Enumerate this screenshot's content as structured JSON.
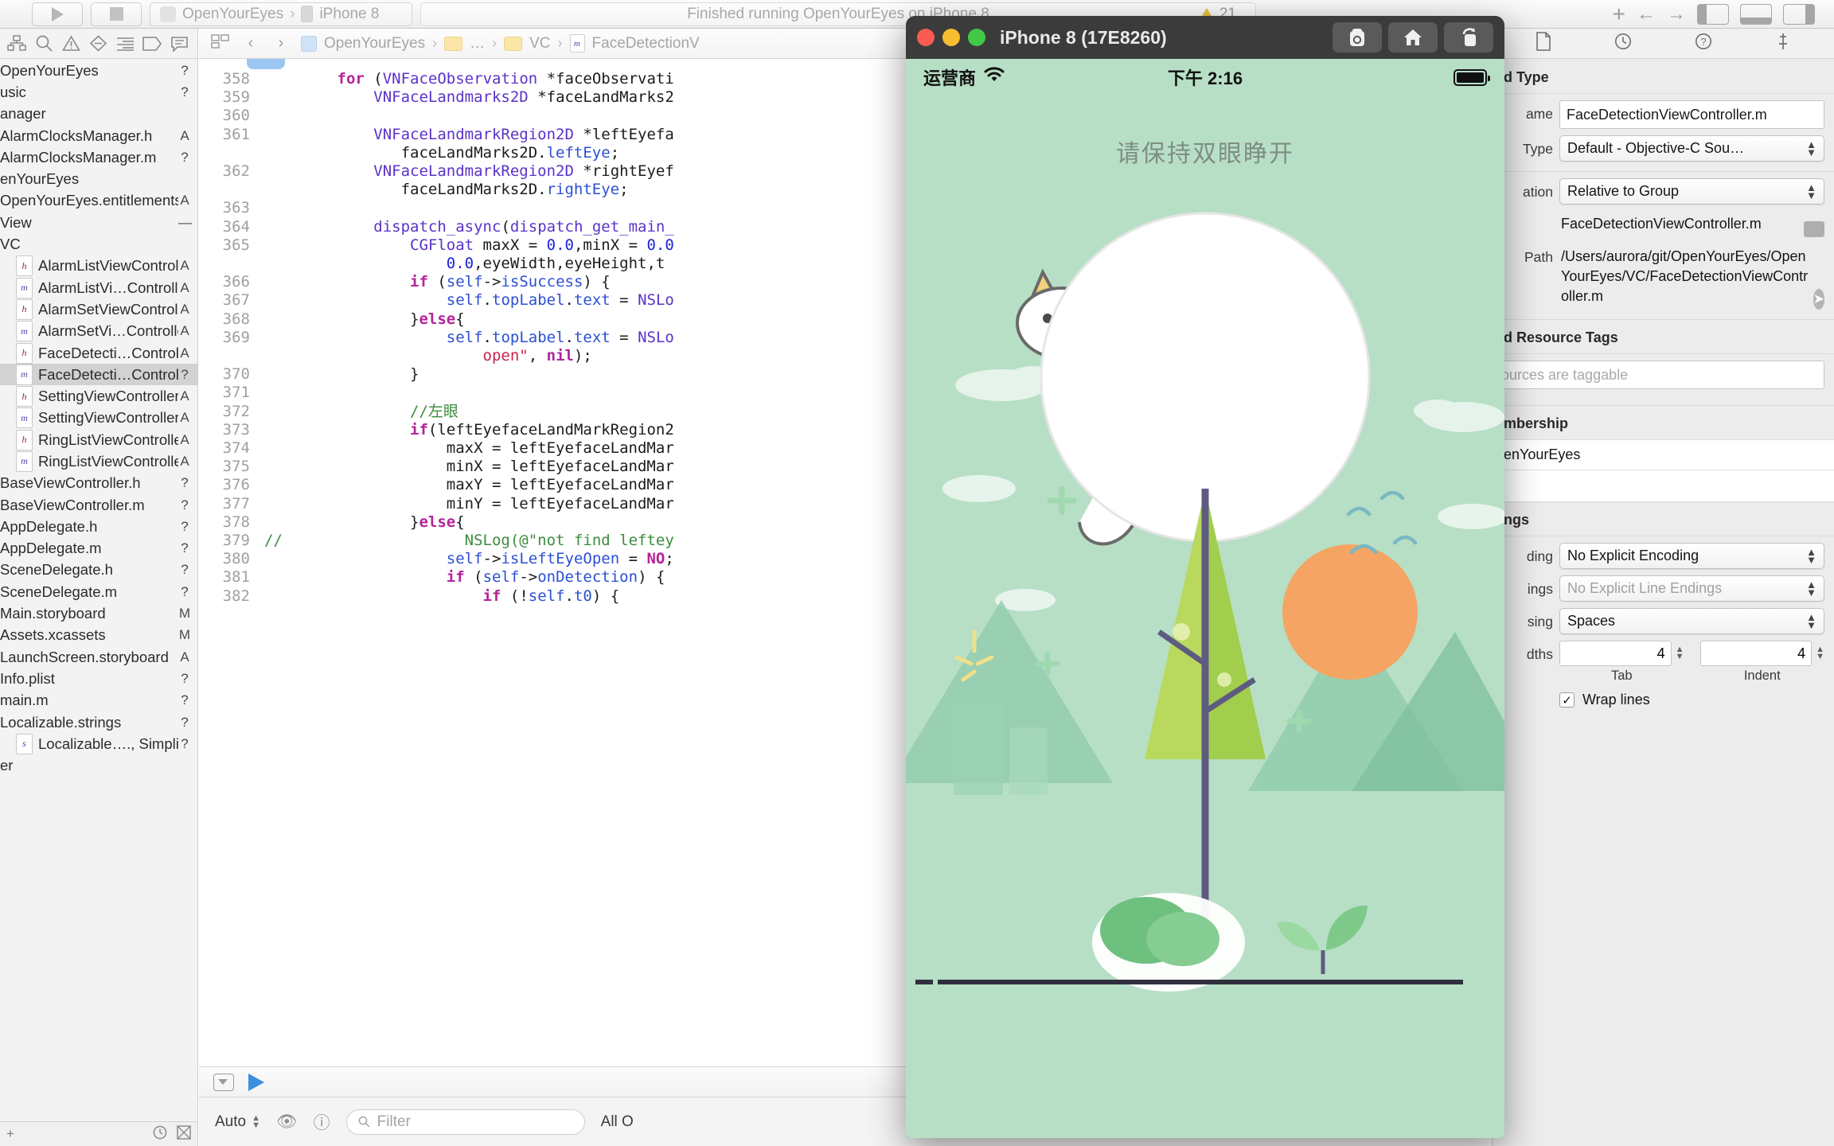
{
  "toolbar": {
    "scheme_project": "OpenYourEyes",
    "scheme_sep": "›",
    "scheme_device": "iPhone 8",
    "status_text": "Finished running OpenYourEyes on iPhone 8",
    "warning_count": "21",
    "add_label": "+"
  },
  "navigator": {
    "tabs": [
      "project-navigator-icon",
      "search-navigator-icon",
      "issue-navigator-icon",
      "test-navigator-icon",
      "report-navigator-icon",
      "breakpoint-navigator-icon",
      "debug-navigator-icon"
    ],
    "items": [
      {
        "label": "OpenYourEyes",
        "status": "?",
        "kind": "group",
        "indent": 0,
        "selected": false
      },
      {
        "label": "usic",
        "status": "?",
        "kind": "group",
        "indent": 0,
        "selected": false
      },
      {
        "label": "anager",
        "status": "",
        "kind": "group",
        "indent": 0,
        "selected": false
      },
      {
        "label": "AlarmClocksManager.h",
        "status": "A",
        "kind": "plain",
        "indent": 0,
        "selected": false
      },
      {
        "label": "AlarmClocksManager.m",
        "status": "?",
        "kind": "plain",
        "indent": 0,
        "selected": false
      },
      {
        "label": "enYourEyes",
        "status": "",
        "kind": "group",
        "indent": 0,
        "selected": false
      },
      {
        "label": "OpenYourEyes.entitlements",
        "status": "A",
        "kind": "plain",
        "indent": 0,
        "selected": false
      },
      {
        "label": "View",
        "status": "—",
        "kind": "group",
        "indent": 0,
        "selected": false
      },
      {
        "label": "VC",
        "status": "",
        "kind": "group",
        "indent": 0,
        "selected": false
      },
      {
        "label": "AlarmListViewController.h",
        "status": "A",
        "kind": "h",
        "indent": 1,
        "selected": false
      },
      {
        "label": "AlarmListVi…Controller.m",
        "status": "A",
        "kind": "m",
        "indent": 1,
        "selected": false
      },
      {
        "label": "AlarmSetViewController.h",
        "status": "A",
        "kind": "h",
        "indent": 1,
        "selected": false
      },
      {
        "label": "AlarmSetVi…Controller.m",
        "status": "A",
        "kind": "m",
        "indent": 1,
        "selected": false
      },
      {
        "label": "FaceDetecti…Controller.h",
        "status": "A",
        "kind": "h",
        "indent": 1,
        "selected": false
      },
      {
        "label": "FaceDetecti…Controller.m",
        "status": "?",
        "kind": "m",
        "indent": 1,
        "selected": true
      },
      {
        "label": "SettingViewController.h",
        "status": "A",
        "kind": "h",
        "indent": 1,
        "selected": false
      },
      {
        "label": "SettingViewController.m",
        "status": "A",
        "kind": "m",
        "indent": 1,
        "selected": false
      },
      {
        "label": "RingListViewController.h",
        "status": "A",
        "kind": "h",
        "indent": 1,
        "selected": false
      },
      {
        "label": "RingListViewController.m",
        "status": "A",
        "kind": "m",
        "indent": 1,
        "selected": false
      },
      {
        "label": "BaseViewController.h",
        "status": "?",
        "kind": "plain",
        "indent": 0,
        "selected": false
      },
      {
        "label": "BaseViewController.m",
        "status": "?",
        "kind": "plain",
        "indent": 0,
        "selected": false
      },
      {
        "label": "AppDelegate.h",
        "status": "?",
        "kind": "plain",
        "indent": 0,
        "selected": false
      },
      {
        "label": "AppDelegate.m",
        "status": "?",
        "kind": "plain",
        "indent": 0,
        "selected": false
      },
      {
        "label": "SceneDelegate.h",
        "status": "?",
        "kind": "plain",
        "indent": 0,
        "selected": false
      },
      {
        "label": "SceneDelegate.m",
        "status": "?",
        "kind": "plain",
        "indent": 0,
        "selected": false
      },
      {
        "label": "Main.storyboard",
        "status": "M",
        "kind": "plain",
        "indent": 0,
        "selected": false
      },
      {
        "label": "Assets.xcassets",
        "status": "M",
        "kind": "plain",
        "indent": 0,
        "selected": false
      },
      {
        "label": "LaunchScreen.storyboard",
        "status": "A",
        "kind": "plain",
        "indent": 0,
        "selected": false
      },
      {
        "label": "Info.plist",
        "status": "?",
        "kind": "plain",
        "indent": 0,
        "selected": false
      },
      {
        "label": "main.m",
        "status": "?",
        "kind": "plain",
        "indent": 0,
        "selected": false
      },
      {
        "label": "Localizable.strings",
        "status": "?",
        "kind": "plain",
        "indent": 0,
        "selected": false
      },
      {
        "label": "Localizable…., Simplified)",
        "status": "?",
        "kind": "strings",
        "indent": 1,
        "selected": false
      },
      {
        "label": "er",
        "status": "",
        "kind": "group",
        "indent": 0,
        "selected": false
      }
    ],
    "footer": {
      "add": "+",
      "filter_icon": "filter-icon",
      "recent_icon": "clock-icon",
      "source_icon": "source-control-icon"
    }
  },
  "editor": {
    "breadcrumb": [
      "OpenYourEyes",
      "…",
      "VC",
      "FaceDetectionV"
    ],
    "nav_back": "‹",
    "nav_fwd": "›",
    "lines": [
      {
        "n": "358",
        "tokens": [
          [
            "sp",
            "        "
          ],
          [
            "kw",
            "for"
          ],
          [
            "pl",
            " ("
          ],
          [
            "ty",
            "VNFaceObservation"
          ],
          [
            "pl",
            " *faceObservati"
          ]
        ]
      },
      {
        "n": "359",
        "tokens": [
          [
            "sp",
            "            "
          ],
          [
            "ty",
            "VNFaceLandmarks2D"
          ],
          [
            "pl",
            " *faceLandMarks2"
          ]
        ]
      },
      {
        "n": "360",
        "tokens": [
          [
            "pl",
            ""
          ]
        ]
      },
      {
        "n": "361",
        "tokens": [
          [
            "sp",
            "            "
          ],
          [
            "ty",
            "VNFaceLandmarkRegion2D"
          ],
          [
            "pl",
            " *leftEyefa"
          ]
        ]
      },
      {
        "n": "",
        "tokens": [
          [
            "sp",
            "               "
          ],
          [
            "pl",
            "faceLandMarks2D."
          ],
          [
            "pr",
            "leftEye"
          ],
          [
            "pl",
            ";"
          ]
        ]
      },
      {
        "n": "362",
        "tokens": [
          [
            "sp",
            "            "
          ],
          [
            "ty",
            "VNFaceLandmarkRegion2D"
          ],
          [
            "pl",
            " *rightEyef"
          ]
        ]
      },
      {
        "n": "",
        "tokens": [
          [
            "sp",
            "               "
          ],
          [
            "pl",
            "faceLandMarks2D."
          ],
          [
            "pr",
            "rightEye"
          ],
          [
            "pl",
            ";"
          ]
        ]
      },
      {
        "n": "363",
        "tokens": [
          [
            "pl",
            ""
          ]
        ]
      },
      {
        "n": "364",
        "tokens": [
          [
            "sp",
            "            "
          ],
          [
            "ty",
            "dispatch_async"
          ],
          [
            "pl",
            "("
          ],
          [
            "ty",
            "dispatch_get_main_"
          ]
        ]
      },
      {
        "n": "365",
        "tokens": [
          [
            "sp",
            "                "
          ],
          [
            "ty",
            "CGFloat"
          ],
          [
            "pl",
            " maxX = "
          ],
          [
            "num",
            "0.0"
          ],
          [
            "pl",
            ",minX = "
          ],
          [
            "num",
            "0.0"
          ]
        ]
      },
      {
        "n": "",
        "tokens": [
          [
            "sp",
            "                    "
          ],
          [
            "num",
            "0.0"
          ],
          [
            "pl",
            ",eyeWidth,eyeHeight,t"
          ]
        ]
      },
      {
        "n": "366",
        "tokens": [
          [
            "sp",
            "                "
          ],
          [
            "kw",
            "if"
          ],
          [
            "pl",
            " ("
          ],
          [
            "pr",
            "self"
          ],
          [
            "pl",
            "->"
          ],
          [
            "pr",
            "isSuccess"
          ],
          [
            "pl",
            ") {"
          ]
        ]
      },
      {
        "n": "367",
        "tokens": [
          [
            "sp",
            "                    "
          ],
          [
            "pr",
            "self"
          ],
          [
            "pl",
            "."
          ],
          [
            "pr",
            "topLabel"
          ],
          [
            "pl",
            "."
          ],
          [
            "pr",
            "text"
          ],
          [
            "pl",
            " = "
          ],
          [
            "ty",
            "NSLo"
          ]
        ]
      },
      {
        "n": "368",
        "tokens": [
          [
            "sp",
            "                "
          ],
          [
            "pl",
            "}"
          ],
          [
            "kw",
            "else"
          ],
          [
            "pl",
            "{"
          ]
        ]
      },
      {
        "n": "369",
        "tokens": [
          [
            "sp",
            "                    "
          ],
          [
            "pr",
            "self"
          ],
          [
            "pl",
            "."
          ],
          [
            "pr",
            "topLabel"
          ],
          [
            "pl",
            "."
          ],
          [
            "pr",
            "text"
          ],
          [
            "pl",
            " = "
          ],
          [
            "ty",
            "NSLo"
          ]
        ]
      },
      {
        "n": "",
        "tokens": [
          [
            "sp",
            "                        "
          ],
          [
            "str",
            "open\""
          ],
          [
            "pl",
            ", "
          ],
          [
            "kw",
            "nil"
          ],
          [
            "pl",
            ");"
          ]
        ]
      },
      {
        "n": "370",
        "tokens": [
          [
            "sp",
            "                "
          ],
          [
            "pl",
            "}"
          ]
        ]
      },
      {
        "n": "371",
        "tokens": [
          [
            "pl",
            ""
          ]
        ]
      },
      {
        "n": "372",
        "tokens": [
          [
            "sp",
            "                "
          ],
          [
            "cmt",
            "//左眼"
          ]
        ]
      },
      {
        "n": "373",
        "tokens": [
          [
            "sp",
            "                "
          ],
          [
            "kw",
            "if"
          ],
          [
            "pl",
            "(leftEyefaceLandMarkRegion2"
          ]
        ]
      },
      {
        "n": "374",
        "tokens": [
          [
            "sp",
            "                    "
          ],
          [
            "pl",
            "maxX = leftEyefaceLandMar"
          ]
        ]
      },
      {
        "n": "375",
        "tokens": [
          [
            "sp",
            "                    "
          ],
          [
            "pl",
            "minX = leftEyefaceLandMar"
          ]
        ]
      },
      {
        "n": "376",
        "tokens": [
          [
            "sp",
            "                    "
          ],
          [
            "pl",
            "maxY = leftEyefaceLandMar"
          ]
        ]
      },
      {
        "n": "377",
        "tokens": [
          [
            "sp",
            "                    "
          ],
          [
            "pl",
            "minY = leftEyefaceLandMar"
          ]
        ]
      },
      {
        "n": "378",
        "tokens": [
          [
            "sp",
            "                "
          ],
          [
            "pl",
            "}"
          ],
          [
            "kw",
            "else"
          ],
          [
            "pl",
            "{"
          ]
        ]
      },
      {
        "n": "379",
        "tokens": [
          [
            "cmtpre",
            "//"
          ],
          [
            "sp",
            "                    "
          ],
          [
            "cmt",
            "NSLog(@\"not find leftey"
          ]
        ]
      },
      {
        "n": "380",
        "tokens": [
          [
            "sp",
            "                    "
          ],
          [
            "pr",
            "self"
          ],
          [
            "pl",
            "->"
          ],
          [
            "pr",
            "isLeftEyeOpen"
          ],
          [
            "pl",
            " = "
          ],
          [
            "kw",
            "NO"
          ],
          [
            "pl",
            ";"
          ]
        ]
      },
      {
        "n": "381",
        "tokens": [
          [
            "sp",
            "                    "
          ],
          [
            "kw",
            "if"
          ],
          [
            "pl",
            " ("
          ],
          [
            "pr",
            "self"
          ],
          [
            "pl",
            "->"
          ],
          [
            "pr",
            "onDetection"
          ],
          [
            "pl",
            ") {"
          ]
        ]
      },
      {
        "n": "382",
        "tokens": [
          [
            "sp",
            "                        "
          ],
          [
            "kw",
            "if"
          ],
          [
            "pl",
            " (!"
          ],
          [
            "pr",
            "self"
          ],
          [
            "pl",
            "."
          ],
          [
            "pr",
            "t0"
          ],
          [
            "pl",
            ") {"
          ]
        ]
      }
    ],
    "console": {
      "auto_label": "Auto",
      "filter_placeholder": "Filter",
      "all_output_label": "All O"
    }
  },
  "inspector": {
    "tabs": [
      "file-inspector-icon",
      "history-inspector-icon",
      "quick-help-icon",
      "pin-icon"
    ],
    "section_identity": "d Type",
    "name_label": "ame",
    "name_value": "FaceDetectionViewController.m",
    "type_label": "Type",
    "type_value": "Default - Objective-C Sou…",
    "location_label": "ation",
    "location_value": "Relative to Group",
    "file_ref": "FaceDetectionViewController.m",
    "path_label": "Path",
    "path_value": "/Users/aurora/git/OpenYourEyes/OpenYourEyes/VC/FaceDetectionViewController.m",
    "section_tags": "d Resource Tags",
    "tags_placeholder": "ources are taggable",
    "section_membership": "mbership",
    "membership_target": "enYourEyes",
    "section_settings": "ngs",
    "encoding_label": "ding",
    "encoding_value": "No Explicit Encoding",
    "line_endings_label": "ings",
    "line_endings_value": "No Explicit Line Endings",
    "indent_using_label": "sing",
    "indent_using_value": "Spaces",
    "widths_label": "dths",
    "tab_value": "4",
    "indent_value": "4",
    "tab_caption": "Tab",
    "indent_caption": "Indent",
    "wrap_lines_label": "Wrap lines",
    "wrap_lines_checked": "✓"
  },
  "simulator": {
    "window_title": "iPhone 8 (17E8260)",
    "buttons": [
      "screenshot-button",
      "home-button",
      "rotate-button"
    ],
    "ios_status": {
      "carrier": "运营商",
      "wifi": "wifi-icon",
      "time": "下午 2:16",
      "battery": "battery-icon"
    },
    "app": {
      "title": "请保持双眼睁开",
      "bg_color": "#b7dfc6",
      "title_color": "#7e8d84"
    }
  }
}
